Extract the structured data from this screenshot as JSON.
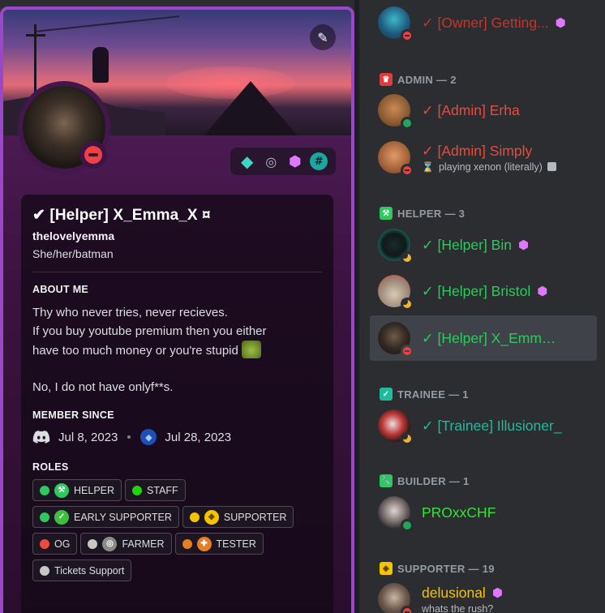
{
  "profile": {
    "edit_icon": "✎",
    "display_name": "✔ [Helper] X_Emma_X ¤",
    "username": "thelovelyemma",
    "pronouns": "She/her/batman",
    "about_title": "ABOUT ME",
    "about_lines": [
      "Thy who never tries, never recieves.",
      "If you buy youtube premium then you either",
      "have too much money or you're stupid",
      "No, I do not have onlyf**s."
    ],
    "member_since_title": "MEMBER SINCE",
    "discord_date": "Jul 8, 2023",
    "server_date": "Jul 28, 2023",
    "roles_title": "ROLES",
    "roles": [
      {
        "label": "HELPER",
        "color": "#2ec95e"
      },
      {
        "label": "STAFF",
        "color": "#23d20a"
      },
      {
        "label": "EARLY SUPPORTER",
        "color": "#2ec95e"
      },
      {
        "label": "SUPPORTER",
        "color": "#f5c400"
      },
      {
        "label": "OG",
        "color": "#e74c3c"
      },
      {
        "label": "FARMER",
        "color": "#c7c7c7"
      },
      {
        "label": "TESTER",
        "color": "#e67e22"
      },
      {
        "label": "Tickets Support",
        "color": "#c7c7c7"
      }
    ],
    "badges": [
      "hypesquad-icon",
      "boost-icon",
      "nitro-icon",
      "hashtag-icon"
    ]
  },
  "members": {
    "owner": {
      "name": "✓ [Owner] Getting...",
      "status": "dnd"
    },
    "admin_header": "ADMIN — 2",
    "admin": [
      {
        "name": "✓ [Admin] Erha",
        "status": "online"
      },
      {
        "name": "✓ [Admin] Simply",
        "status": "dnd",
        "activity": "playing xenon (literally)"
      }
    ],
    "helper_header": "HELPER — 3",
    "helper": [
      {
        "name": "✓ [Helper] Bin",
        "status": "idle"
      },
      {
        "name": "✓ [Helper] Bristol",
        "status": "idle"
      },
      {
        "name": "✓ [Helper] X_Emma_...",
        "status": "dnd"
      }
    ],
    "trainee_header": "TRAINEE — 1",
    "trainee": [
      {
        "name": "✓ [Trainee] Illusioner_",
        "status": "idle"
      }
    ],
    "builder_header": "BUILDER — 1",
    "builder": [
      {
        "name": "PROxxCHF",
        "status": "online"
      }
    ],
    "supporter_header": "SUPPORTER — 19",
    "supporter": [
      {
        "name": "delusional",
        "status": "dnd",
        "activity": "whats the rush?"
      }
    ]
  }
}
